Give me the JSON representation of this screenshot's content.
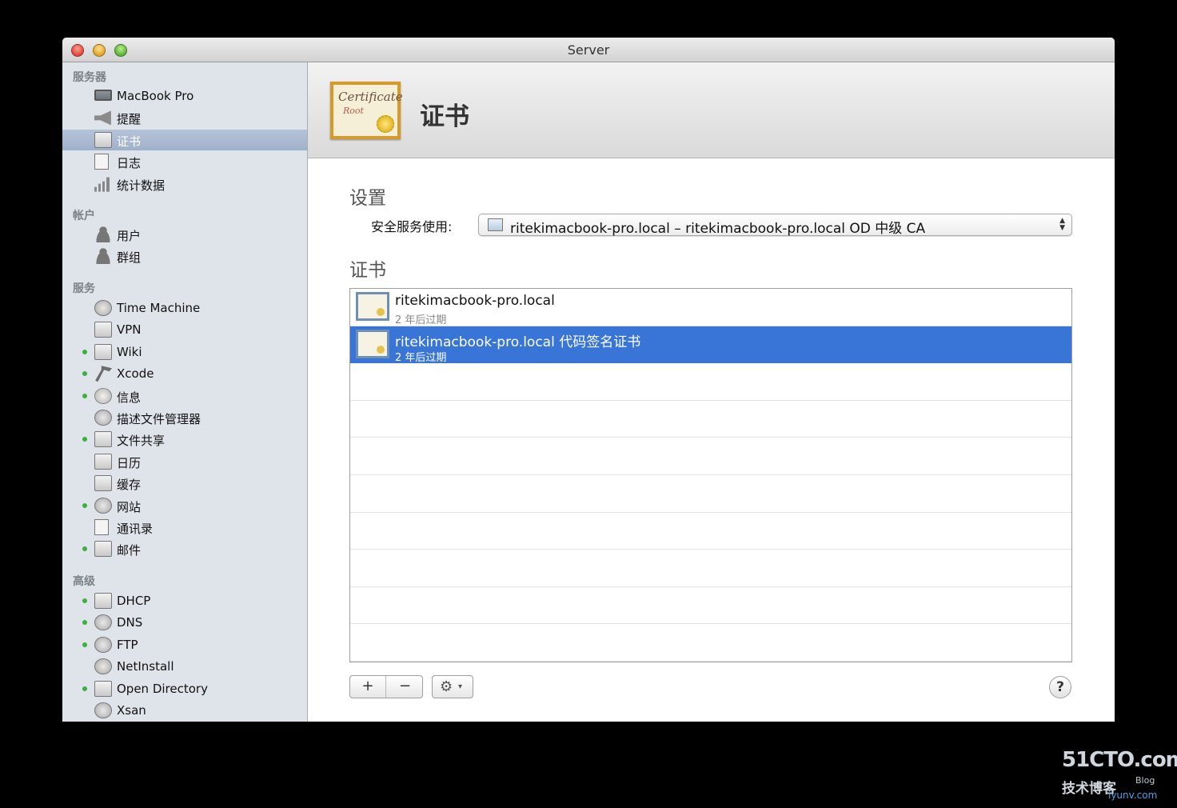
{
  "window": {
    "title": "Server"
  },
  "sidebar": {
    "sections": [
      {
        "header": "服务器",
        "items": [
          {
            "label": "MacBook Pro",
            "icon": "laptop-icon",
            "dot": false,
            "selected": false
          },
          {
            "label": "提醒",
            "icon": "megaphone-icon",
            "dot": false,
            "selected": false
          },
          {
            "label": "证书",
            "icon": "certificate-icon",
            "dot": false,
            "selected": true
          },
          {
            "label": "日志",
            "icon": "log-icon",
            "dot": false,
            "selected": false
          },
          {
            "label": "统计数据",
            "icon": "stats-icon",
            "dot": false,
            "selected": false
          }
        ]
      },
      {
        "header": "帐户",
        "items": [
          {
            "label": "用户",
            "icon": "user-icon",
            "dot": false,
            "selected": false
          },
          {
            "label": "群组",
            "icon": "group-icon",
            "dot": false,
            "selected": false
          }
        ]
      },
      {
        "header": "服务",
        "items": [
          {
            "label": "Time Machine",
            "icon": "time-machine-icon",
            "dot": false,
            "selected": false
          },
          {
            "label": "VPN",
            "icon": "lock-icon",
            "dot": false,
            "selected": false
          },
          {
            "label": "Wiki",
            "icon": "wiki-icon",
            "dot": true,
            "selected": false
          },
          {
            "label": "Xcode",
            "icon": "hammer-icon",
            "dot": true,
            "selected": false
          },
          {
            "label": "信息",
            "icon": "message-bubble-icon",
            "dot": true,
            "selected": false
          },
          {
            "label": "描述文件管理器",
            "icon": "profile-manager-icon",
            "dot": false,
            "selected": false
          },
          {
            "label": "文件共享",
            "icon": "folder-icon",
            "dot": true,
            "selected": false
          },
          {
            "label": "日历",
            "icon": "calendar-icon",
            "dot": false,
            "selected": false
          },
          {
            "label": "缓存",
            "icon": "cache-icon",
            "dot": false,
            "selected": false
          },
          {
            "label": "网站",
            "icon": "globe-icon",
            "dot": true,
            "selected": false
          },
          {
            "label": "通讯录",
            "icon": "contacts-icon",
            "dot": false,
            "selected": false
          },
          {
            "label": "邮件",
            "icon": "mail-icon",
            "dot": true,
            "selected": false
          }
        ]
      },
      {
        "header": "高级",
        "items": [
          {
            "label": "DHCP",
            "icon": "dhcp-icon",
            "dot": true,
            "selected": false
          },
          {
            "label": "DNS",
            "icon": "dns-icon",
            "dot": true,
            "selected": false
          },
          {
            "label": "FTP",
            "icon": "ftp-icon",
            "dot": true,
            "selected": false
          },
          {
            "label": "NetInstall",
            "icon": "netinstall-icon",
            "dot": false,
            "selected": false
          },
          {
            "label": "Open Directory",
            "icon": "open-directory-icon",
            "dot": true,
            "selected": false
          },
          {
            "label": "Xsan",
            "icon": "xsan-icon",
            "dot": false,
            "selected": false
          }
        ]
      }
    ]
  },
  "header": {
    "title": "证书",
    "icon": "certificate-icon",
    "icon_text_1": "Certificate",
    "icon_text_2": "Root"
  },
  "settings": {
    "heading": "设置",
    "ssl_label": "安全服务使用:",
    "ssl_value": "ritekimacbook-pro.local – ritekimacbook-pro.local OD 中级 CA"
  },
  "certificates": {
    "heading": "证书",
    "rows": [
      {
        "name": "ritekimacbook-pro.local",
        "expiry": "2 年后过期",
        "selected": false
      },
      {
        "name": "ritekimacbook-pro.local 代码签名证书",
        "expiry": "2 年后过期",
        "selected": true
      }
    ],
    "empty_rows": 8
  },
  "toolbar": {
    "add_label": "+",
    "remove_label": "−",
    "gear_label": "⚙",
    "gear_caret": "▾",
    "help_label": "?"
  },
  "watermark": {
    "main": "51CTO.com",
    "sub": "技术博客",
    "blog": "Blog",
    "url": "iyunv.com"
  },
  "colors": {
    "selection": "#3875d7",
    "sidebar_bg": "#dfe4ea",
    "status_dot": "#3bb03b"
  }
}
